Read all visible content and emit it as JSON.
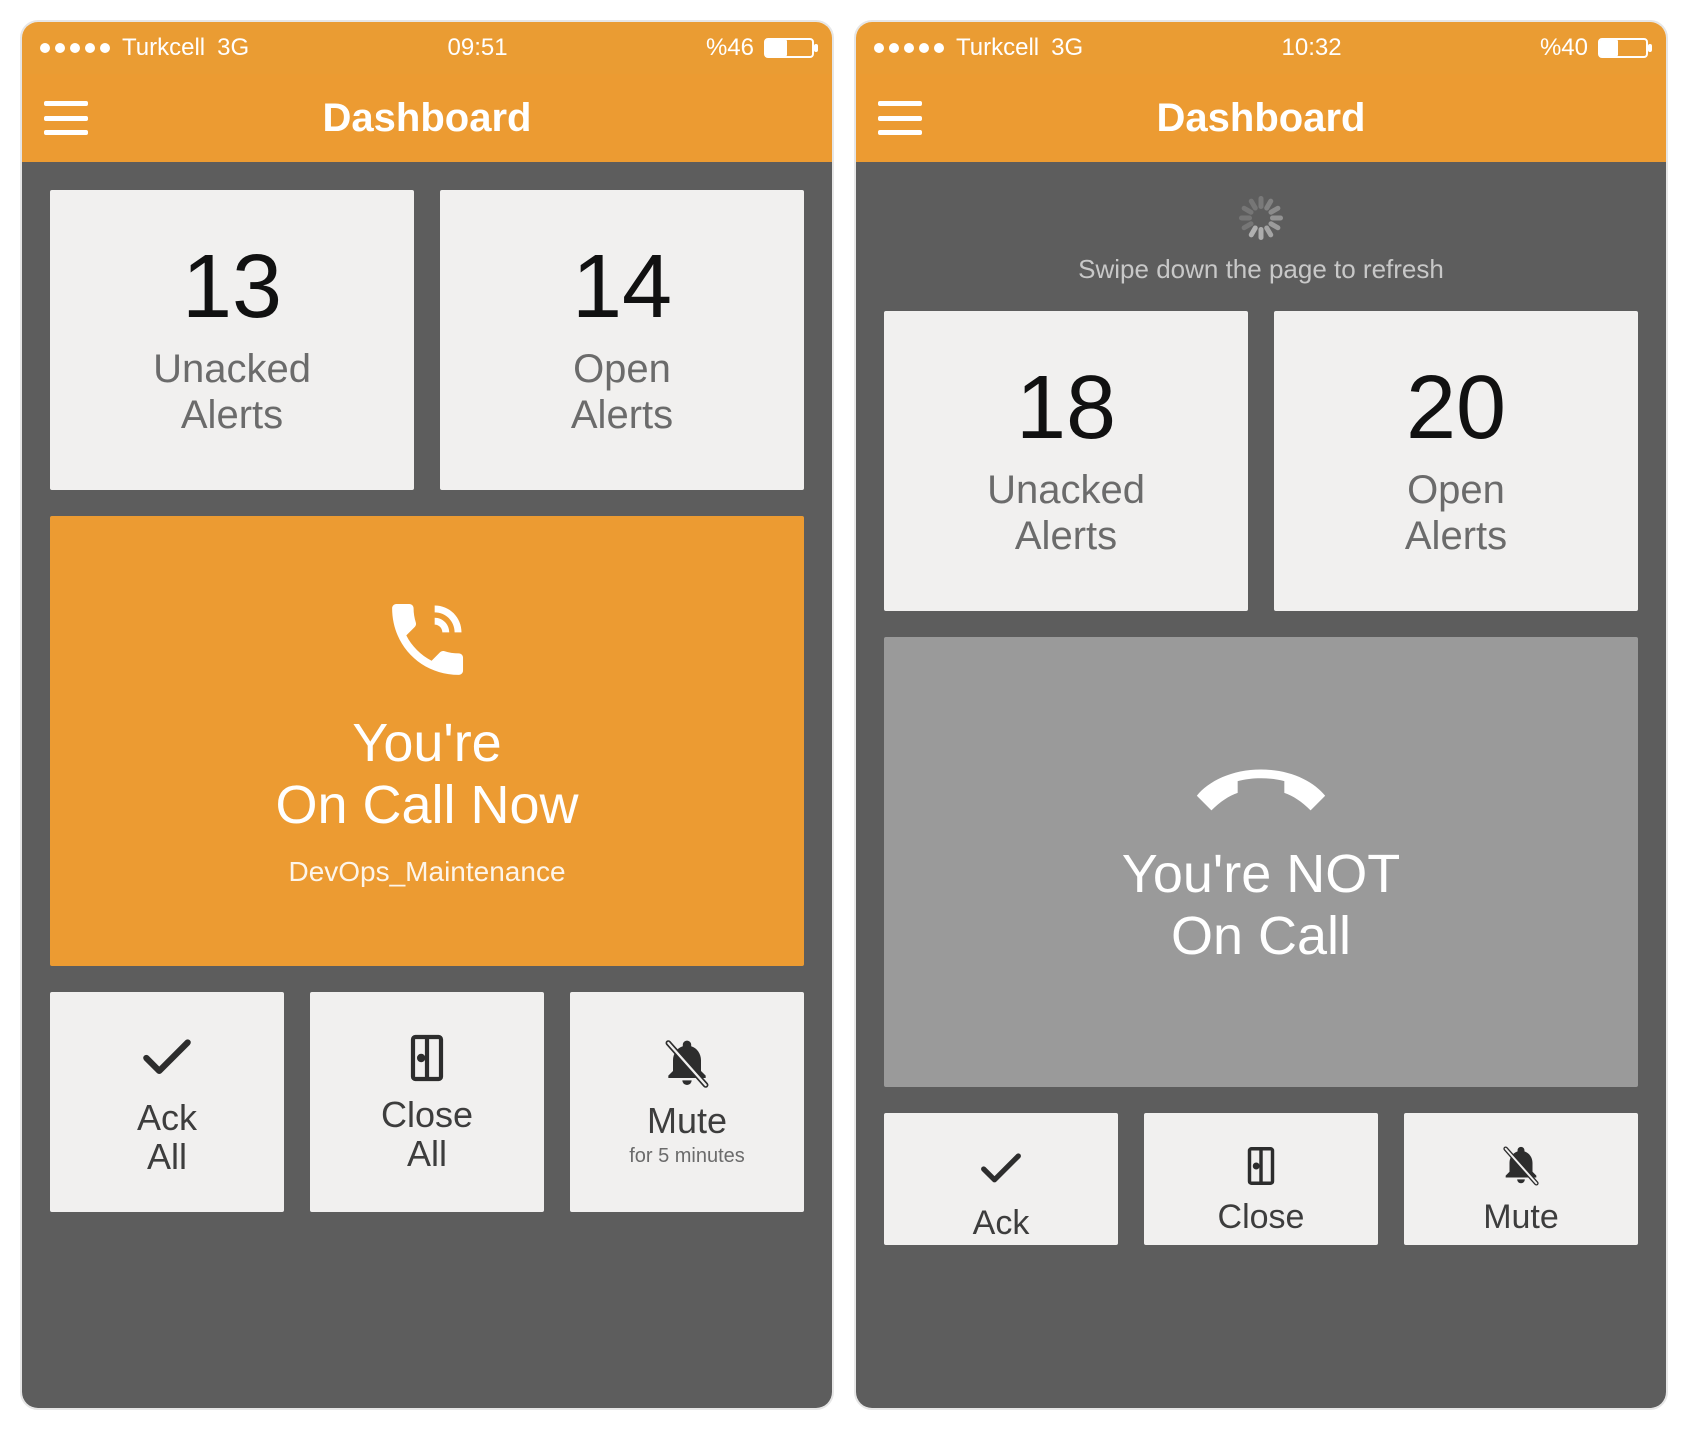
{
  "colors": {
    "accent": "#ec9b32",
    "bg_dark": "#5d5d5d",
    "tile_bg": "#f1f0ef",
    "gray_hero": "#9a9a9a"
  },
  "screens": [
    {
      "statusbar": {
        "carrier": "Turkcell",
        "network": "3G",
        "time": "09:51",
        "battery_label": "%46",
        "battery_pct": 46
      },
      "header": {
        "title": "Dashboard"
      },
      "refresh_hint": null,
      "counts": {
        "unacked": {
          "value": "13",
          "label": "Unacked\nAlerts"
        },
        "open": {
          "value": "14",
          "label": "Open\nAlerts"
        }
      },
      "hero": {
        "variant": "on_call",
        "icon": "phone-ring-icon",
        "line": "You're\nOn Call Now",
        "sub": "DevOps_Maintenance"
      },
      "actions": {
        "ack": {
          "icon": "check-icon",
          "label": "Ack\nAll",
          "sub": null
        },
        "close": {
          "icon": "door-exit-icon",
          "label": "Close\nAll",
          "sub": null
        },
        "mute": {
          "icon": "bell-slash-icon",
          "label": "Mute",
          "sub": "for 5 minutes"
        }
      }
    },
    {
      "statusbar": {
        "carrier": "Turkcell",
        "network": "3G",
        "time": "10:32",
        "battery_label": "%40",
        "battery_pct": 40
      },
      "header": {
        "title": "Dashboard"
      },
      "refresh_hint": "Swipe down the page to refresh",
      "counts": {
        "unacked": {
          "value": "18",
          "label": "Unacked\nAlerts"
        },
        "open": {
          "value": "20",
          "label": "Open\nAlerts"
        }
      },
      "hero": {
        "variant": "not_on_call",
        "icon": "phone-down-icon",
        "line": "You're NOT\nOn Call",
        "sub": null
      },
      "actions": {
        "ack": {
          "icon": "check-icon",
          "label": "Ack",
          "sub": null
        },
        "close": {
          "icon": "door-exit-icon",
          "label": "Close",
          "sub": null
        },
        "mute": {
          "icon": "bell-slash-icon",
          "label": "Mute",
          "sub": null
        }
      }
    }
  ]
}
